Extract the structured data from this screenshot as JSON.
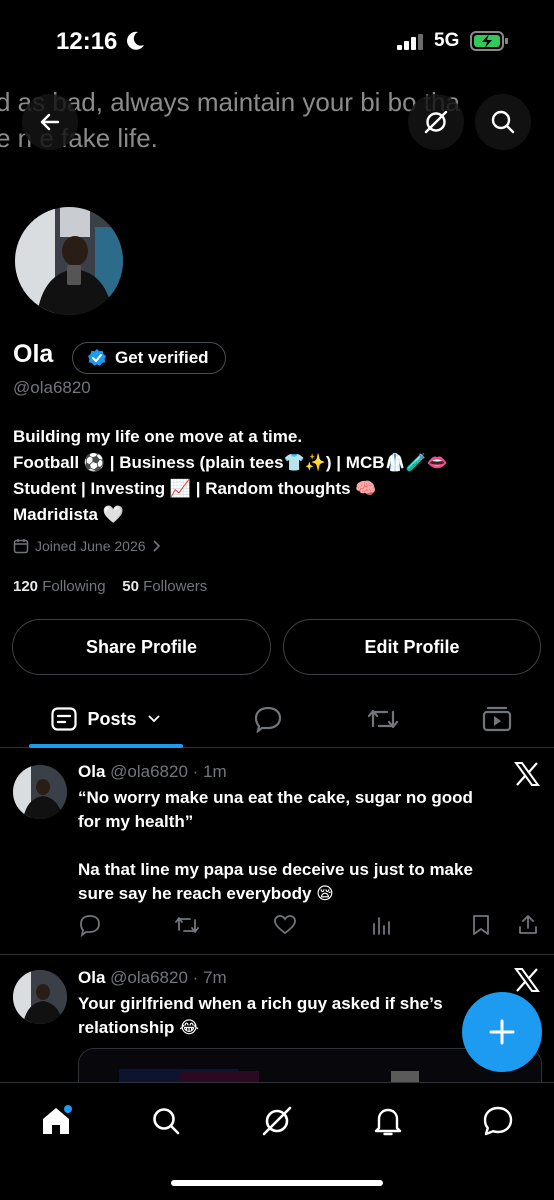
{
  "status_bar": {
    "time": "12:16",
    "network": "5G"
  },
  "banner": {
    "line1": "d as   bad, always maintain your bi  bo   tha",
    "line2": "e n     e fake life."
  },
  "profile": {
    "name": "Ola",
    "verify_label": "Get verified",
    "handle": "@ola6820",
    "bio": [
      "Building my life one move at a time.",
      "Football ⚽ | Business (plain tees👕✨) | MCB🥼🧪👄",
      "Student | Investing 📈 | Random thoughts 🧠",
      "Madridista 🤍"
    ],
    "joined": "Joined June 2026",
    "following_count": "120",
    "following_label": "Following",
    "followers_count": "50",
    "followers_label": "Followers",
    "share_label": "Share Profile",
    "edit_label": "Edit Profile"
  },
  "tabs": {
    "posts_label": "Posts"
  },
  "posts": [
    {
      "name": "Ola",
      "handle": "@ola6820",
      "time": "· 1m",
      "lines": [
        "“No worry make una eat the cake, sugar no good",
        "for my health”",
        "",
        "Na that line my papa use deceive us just to make",
        "sure say he reach everybody 😪"
      ]
    },
    {
      "name": "Ola",
      "handle": "@ola6820",
      "time": "· 7m",
      "lines": [
        "Your girlfriend when a rich guy asked if she’s",
        "relationship 😂"
      ]
    }
  ],
  "colors": {
    "accent": "#1d9bf0",
    "background": "#000000",
    "muted": "#71767b"
  }
}
